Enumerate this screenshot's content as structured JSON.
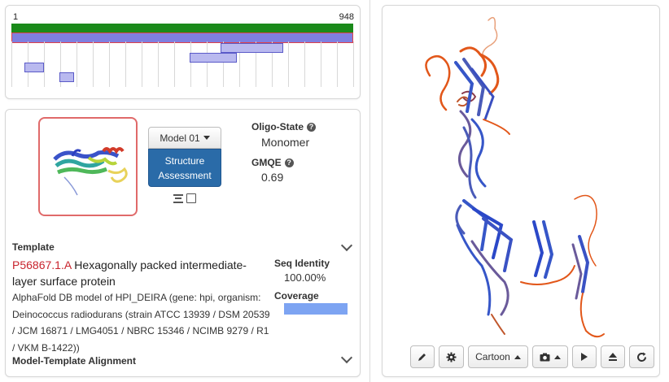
{
  "coverage": {
    "start": "1",
    "end": "948"
  },
  "model": {
    "selector_label": "Model 01",
    "assessment_label": "Structure\nAssessment",
    "oligo_state_label": "Oligo-State",
    "oligo_state_value": "Monomer",
    "gmqe_label": "GMQE",
    "gmqe_value": "0.69"
  },
  "template": {
    "section_title": "Template",
    "id": "P56867.1.A",
    "description": "Hexagonally packed intermediate-layer surface protein",
    "details": "AlphaFold DB model of HPI_DEIRA (gene: hpi, organism: Deinococcus radiodurans (strain ATCC 13939 / DSM 20539 / JCM 16871 / LMG4051 / NBRC 15346 / NCIMB 9279 / R1 / VKM B-1422))",
    "seq_identity_label": "Seq Identity",
    "seq_identity_value": "100.00%",
    "coverage_label": "Coverage",
    "coverage_fraction": 1.0
  },
  "alignment": {
    "section_title": "Model-Template Alignment"
  },
  "viewer": {
    "style_label": "Cartoon",
    "icons": [
      "pencil-icon",
      "gear-icon",
      "camera-icon",
      "play-icon",
      "eject-icon",
      "refresh-icon"
    ]
  },
  "colors": {
    "accent_blue": "#2a6ba8",
    "template_id_red": "#c8232c",
    "coverage_green": "#1a8a1a",
    "coverage_blue": "#7f7fe0",
    "helix_orange": "#e2571a",
    "sheet_blue": "#3656c8"
  }
}
